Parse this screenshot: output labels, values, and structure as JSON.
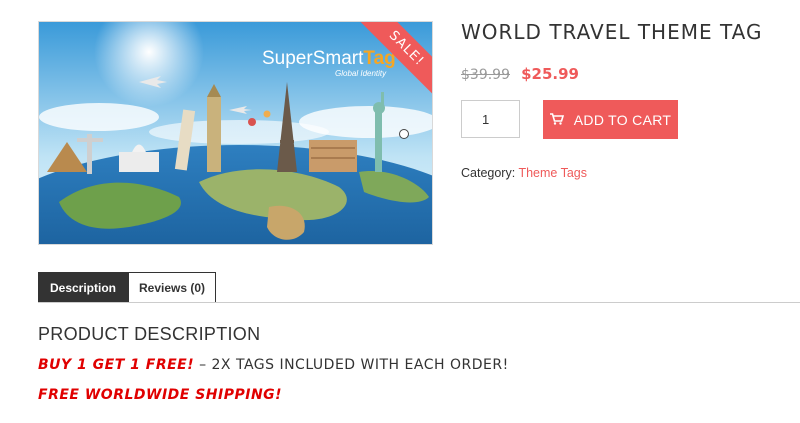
{
  "product": {
    "title": "WORLD TRAVEL THEME TAG",
    "price_old": "$39.99",
    "price_new": "$25.99",
    "sale_badge": "SALE!",
    "image_brand": {
      "part1": "SuperSmart",
      "part2": "Tag",
      "tagline": "Global Identity"
    },
    "quantity": "1",
    "add_to_cart_label": "ADD TO CART",
    "category_label": "Category:",
    "category_link": "Theme Tags"
  },
  "tabs": [
    {
      "label": "Description"
    },
    {
      "label": "Reviews (0)"
    }
  ],
  "description": {
    "heading": "PRODUCT DESCRIPTION",
    "line1_red": "BUY 1 GET 1 FREE!",
    "line1_rest": " – 2X TAGS INCLUDED WITH EACH ORDER!",
    "line2_red": "FREE WORLDWIDE SHIPPING!"
  },
  "colors": {
    "accent": "#ef5a5a",
    "promo_red": "#e00000",
    "tab_active": "#333333"
  },
  "icons": {
    "cart": "cart-icon"
  }
}
